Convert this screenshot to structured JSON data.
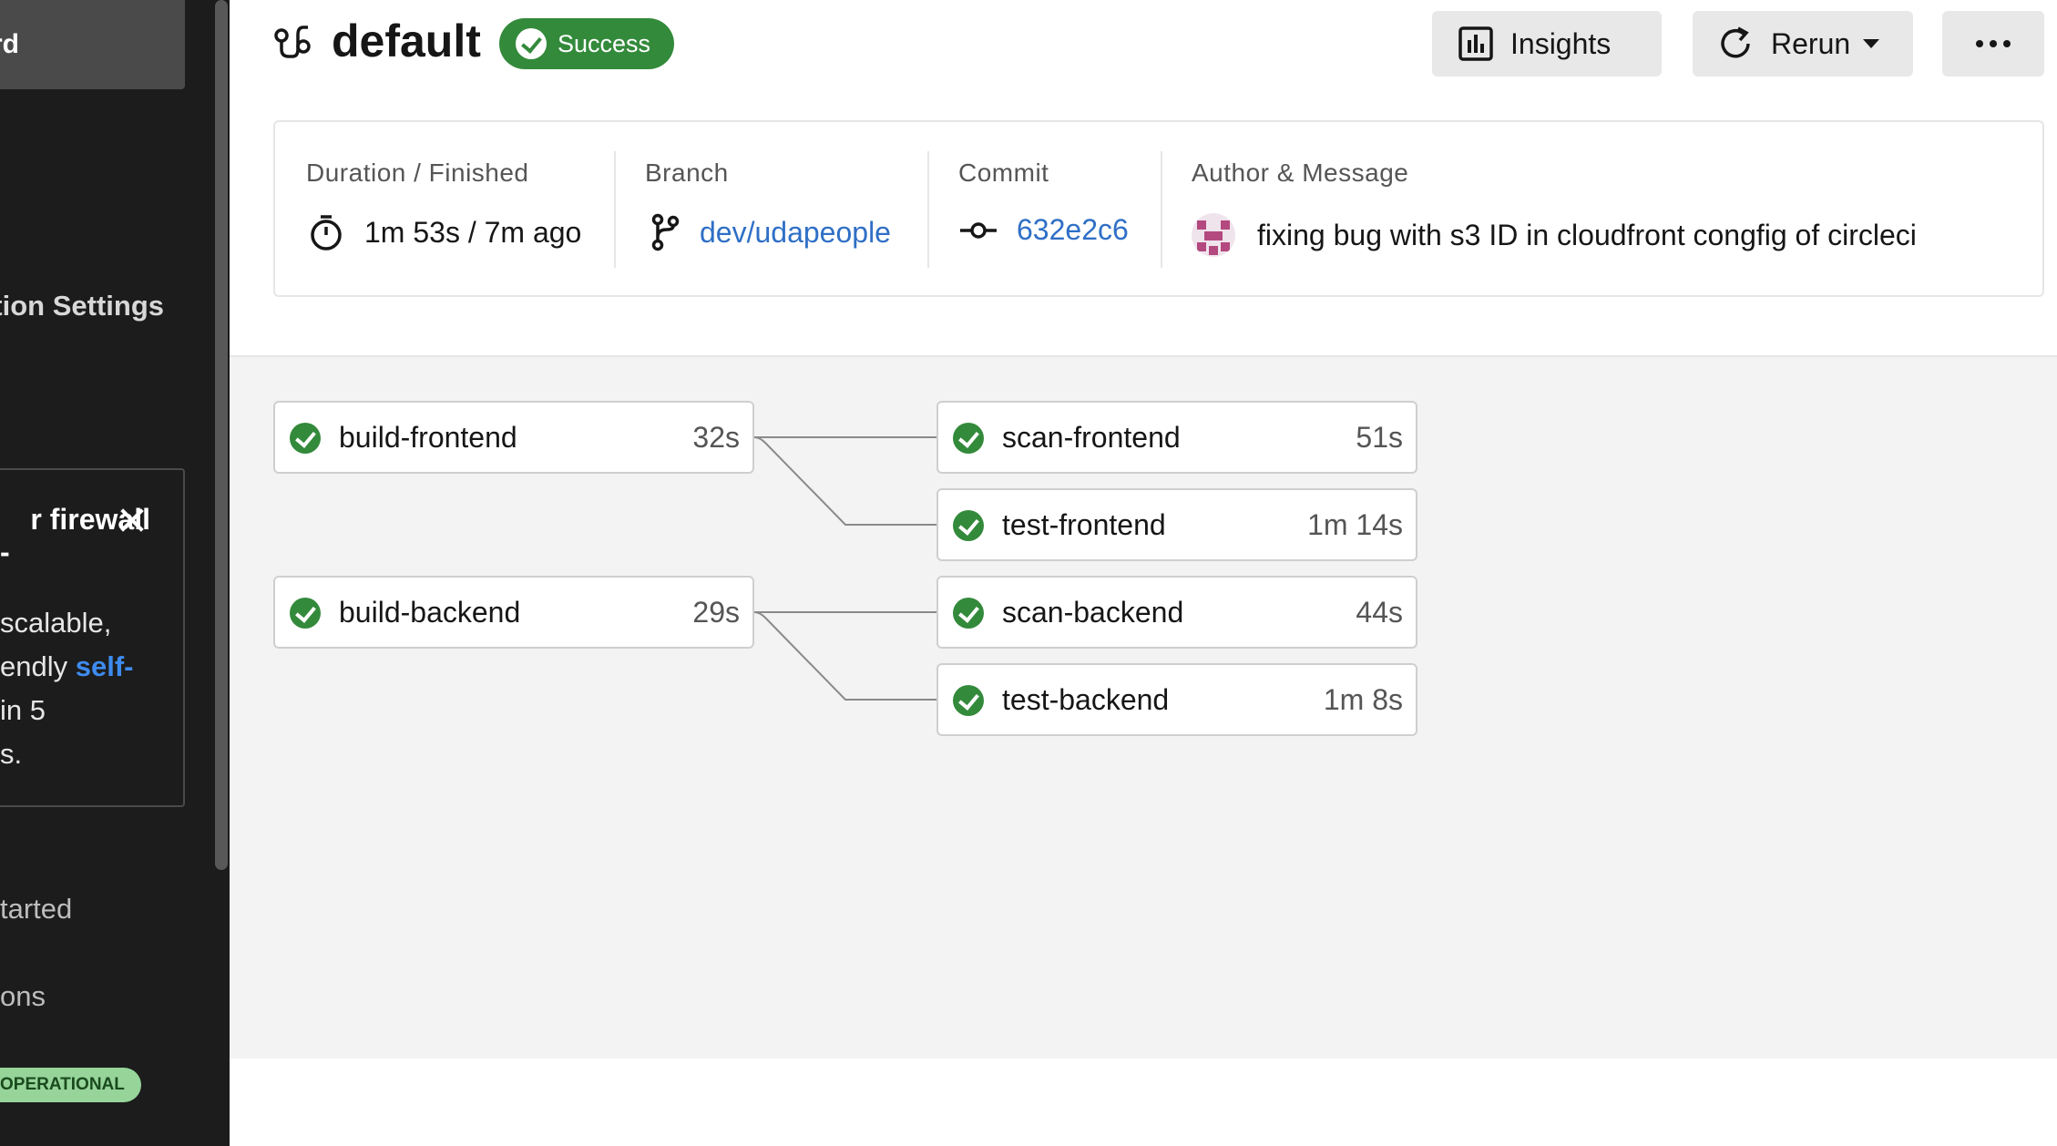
{
  "sidebar": {
    "dashboard_label": "rd",
    "org_settings_label": "tion Settings",
    "card": {
      "title_line1": "r firewall",
      "title_line2": "-",
      "body_line1": "scalable,",
      "body_line2_text": "endly ",
      "body_line2_link": "self-",
      "body_line3": " in 5",
      "body_line4": "s."
    },
    "link_1": "tarted",
    "link_2": "ons",
    "status_badge": "OPERATIONAL"
  },
  "header": {
    "workflow_name": "default",
    "status": "Success",
    "insights_label": "Insights",
    "rerun_label": "Rerun"
  },
  "summary": {
    "duration_label": "Duration / Finished",
    "duration_value": "1m 53s / 7m ago",
    "branch_label": "Branch",
    "branch_value": "dev/udapeople",
    "commit_label": "Commit",
    "commit_value": "632e2c6",
    "author_label": "Author & Message",
    "commit_message": "fixing bug with s3 ID in cloudfront congfig of circleci"
  },
  "jobs": [
    {
      "name": "build-frontend",
      "duration": "32s",
      "status": "success"
    },
    {
      "name": "scan-frontend",
      "duration": "51s",
      "status": "success"
    },
    {
      "name": "test-frontend",
      "duration": "1m 14s",
      "status": "success"
    },
    {
      "name": "build-backend",
      "duration": "29s",
      "status": "success"
    },
    {
      "name": "scan-backend",
      "duration": "44s",
      "status": "success"
    },
    {
      "name": "test-backend",
      "duration": "1m 8s",
      "status": "success"
    }
  ],
  "colors": {
    "success": "#338a3b",
    "link": "#2f6fc6",
    "sidebar_bg": "#1c1c1c",
    "graph_bg": "#f3f3f3"
  }
}
